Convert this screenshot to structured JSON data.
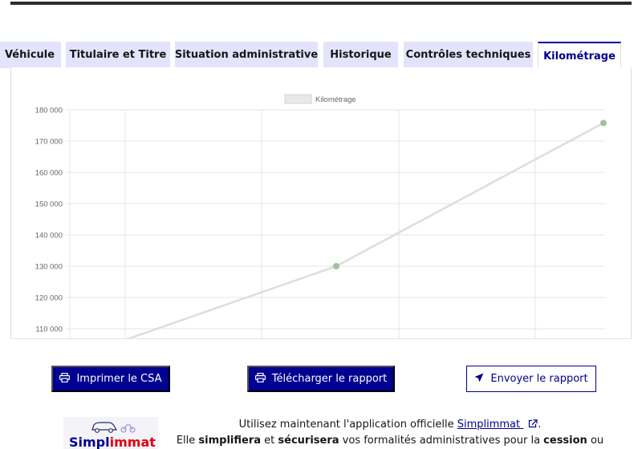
{
  "tabs": [
    {
      "label": "Véhicule"
    },
    {
      "label": "Titulaire et Titre"
    },
    {
      "label": "Situation administrative"
    },
    {
      "label": "Historique"
    },
    {
      "label": "Contrôles techniques"
    },
    {
      "label": "Kilométrage"
    }
  ],
  "active_tab": "Kilométrage",
  "chart_data": {
    "type": "line",
    "series": [
      {
        "name": "Kilométrage",
        "points": [
          [
            0,
            106000
          ],
          [
            1,
            130000
          ],
          [
            2,
            175800
          ]
        ]
      }
    ],
    "ytick_labels": [
      "180 000",
      "170 000",
      "160 000",
      "150 000",
      "140 000",
      "130 000",
      "120 000",
      "110 000"
    ],
    "yticks": [
      180000,
      170000,
      160000,
      150000,
      140000,
      130000,
      120000,
      110000
    ],
    "ylim": [
      107000,
      180000
    ],
    "grid": true,
    "legend_position": "top-center",
    "line_color": "#dddddd",
    "point_color": "#9cc49a"
  },
  "buttons": {
    "print_csa": "Imprimer le CSA",
    "download_report": "Télécharger le rapport",
    "send_report": "Envoyer le rapport"
  },
  "promo": {
    "logo_prefix": "Simpl",
    "logo_suffix": "immat",
    "line1_before": "Utilisez maintenant l'application officielle ",
    "link": "Simplimmat",
    "line1_after": ".",
    "line2_a": "Elle ",
    "line2_b": "simplifiera",
    "line2_c": " et ",
    "line2_d": "sécurisera",
    "line2_e": " vos formalités administratives pour la ",
    "line2_f": "cession",
    "line2_g": " ou"
  },
  "colors": {
    "primary": "#000091",
    "tab_bg": "#e3e3fd",
    "accent_red": "#e1000f"
  }
}
